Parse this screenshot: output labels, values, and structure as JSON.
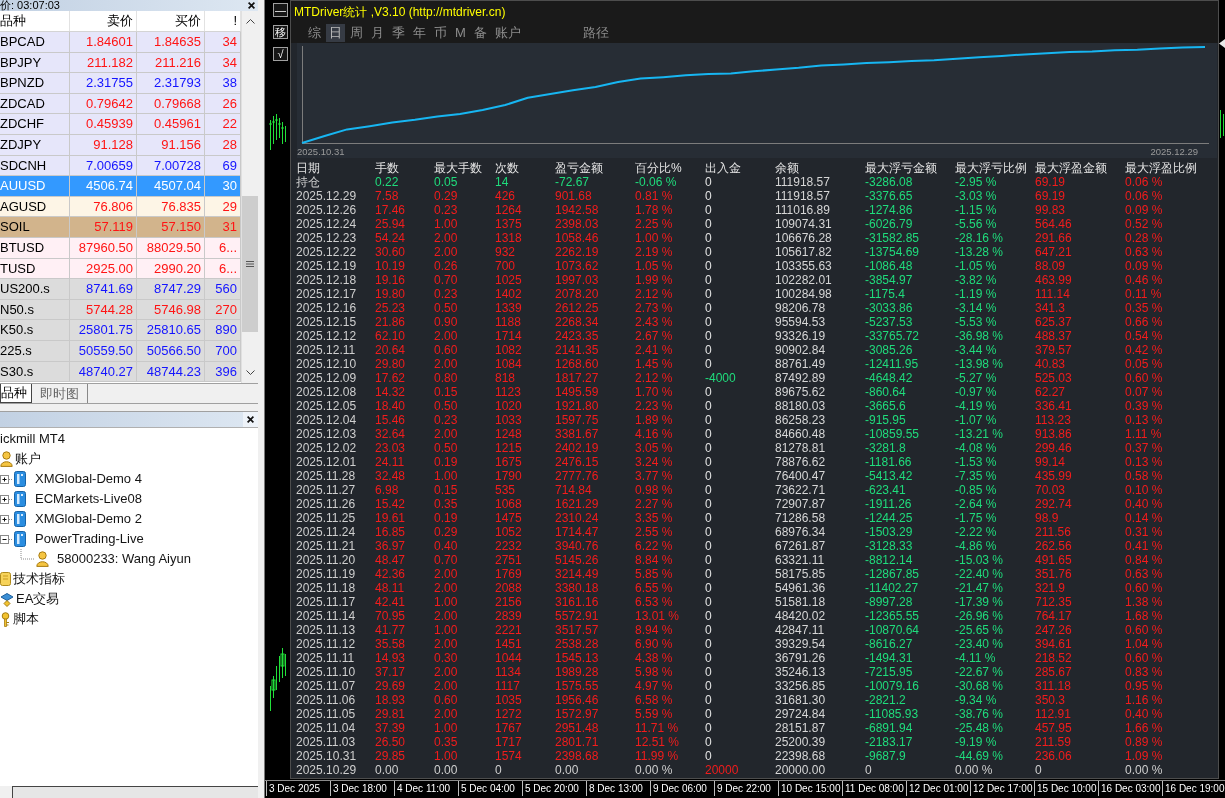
{
  "market_watch": {
    "time_label": "价: 03:07:03",
    "columns": [
      "品种",
      "卖价",
      "买价",
      "!"
    ],
    "rows": [
      {
        "symbol": "BPCAD",
        "bid": "1.84601",
        "ask": "1.84635",
        "spread": "34",
        "rising": false,
        "color": "#e6e6fa",
        "selected": false
      },
      {
        "symbol": "BPJPY",
        "bid": "211.182",
        "ask": "211.216",
        "spread": "34",
        "rising": false,
        "color": "#e6e6fa",
        "selected": false
      },
      {
        "symbol": "BPNZD",
        "bid": "2.31755",
        "ask": "2.31793",
        "spread": "38",
        "rising": true,
        "color": "#e6e6fa",
        "selected": false
      },
      {
        "symbol": "ZDCAD",
        "bid": "0.79642",
        "ask": "0.79668",
        "spread": "26",
        "rising": false,
        "color": "#e6e6fa",
        "selected": false
      },
      {
        "symbol": "ZDCHF",
        "bid": "0.45939",
        "ask": "0.45961",
        "spread": "22",
        "rising": false,
        "color": "#e6e6fa",
        "selected": false
      },
      {
        "symbol": "ZDJPY",
        "bid": "91.128",
        "ask": "91.156",
        "spread": "28",
        "rising": false,
        "color": "#e6e6fa",
        "selected": false
      },
      {
        "symbol": "SDCNH",
        "bid": "7.00659",
        "ask": "7.00728",
        "spread": "69",
        "rising": true,
        "color": "#e6e6fa",
        "selected": false
      },
      {
        "symbol": "AUUSD",
        "bid": "4506.74",
        "ask": "4507.04",
        "spread": "30",
        "selected": true
      },
      {
        "symbol": "AGUSD",
        "bid": "76.806",
        "ask": "76.835",
        "spread": "29",
        "rising": false,
        "color": "#fdf5e6",
        "selected": false
      },
      {
        "symbol": "SOIL",
        "bid": "57.119",
        "ask": "57.150",
        "spread": "31",
        "rising": false,
        "color": "#d2b48c",
        "selected": false
      },
      {
        "symbol": "BTUSD",
        "bid": "87960.50",
        "ask": "88029.50",
        "spread": "6...",
        "rising": false,
        "color": "#fff0f5",
        "selected": false
      },
      {
        "symbol": "TUSD",
        "bid": "2925.00",
        "ask": "2990.20",
        "spread": "6...",
        "rising": false,
        "color": "#fff0f5",
        "selected": false
      },
      {
        "symbol": "US200.s",
        "bid": "8741.69",
        "ask": "8747.29",
        "spread": "560",
        "rising": true,
        "color": "#dcdcdc",
        "selected": false
      },
      {
        "symbol": "N50.s",
        "bid": "5744.28",
        "ask": "5746.98",
        "spread": "270",
        "rising": false,
        "color": "#dcdcdc",
        "selected": false
      },
      {
        "symbol": "K50.s",
        "bid": "25801.75",
        "ask": "25810.65",
        "spread": "890",
        "rising": true,
        "color": "#dcdcdc",
        "selected": false
      },
      {
        "symbol": "225.s",
        "bid": "50559.50",
        "ask": "50566.50",
        "spread": "700",
        "rising": true,
        "color": "#dcdcdc",
        "selected": false
      },
      {
        "symbol": "S30.s",
        "bid": "48740.27",
        "ask": "48744.23",
        "spread": "396",
        "rising": true,
        "color": "#dcdcdc",
        "selected": false
      }
    ],
    "tabs": [
      {
        "label": "品种",
        "selected": true
      },
      {
        "label": "即时图",
        "selected": false
      }
    ]
  },
  "navigator": {
    "items": [
      {
        "label": "ickmill MT4",
        "children": [
          {
            "label": "账户",
            "kind": "accounts",
            "children": [
              {
                "label": "XMGlobal-Demo 4",
                "kind": "server",
                "expanded": false
              },
              {
                "label": "ECMarkets-Live08",
                "kind": "server",
                "expanded": false
              },
              {
                "label": "XMGlobal-Demo 2",
                "kind": "server",
                "expanded": false
              },
              {
                "label": "PowerTrading-Live",
                "kind": "server",
                "expanded": true,
                "children": [
                  {
                    "label": "58000233: Wang Aiyun",
                    "kind": "account"
                  }
                ]
              }
            ]
          },
          {
            "label": "技术指标",
            "kind": "indicators"
          },
          {
            "label": "EA交易",
            "kind": "experts"
          },
          {
            "label": "脚本",
            "kind": "scripts"
          }
        ]
      }
    ]
  },
  "price_chart": {
    "side_buttons": [
      "—",
      "移",
      "√"
    ],
    "time_axis": [
      "3 Dec 2025",
      "3 Dec 18:00",
      "4 Dec 11:00",
      "5 Dec 04:00",
      "5 Dec 20:00",
      "8 Dec 13:00",
      "9 Dec 06:00",
      "9 Dec 22:00",
      "10 Dec 15:00",
      "11 Dec 08:00",
      "12 Dec 01:00",
      "12 Dec 17:00",
      "15 Dec 10:00",
      "16 Dec 03:00",
      "16 Dec 19:00"
    ]
  },
  "stats_panel": {
    "title": "MTDriver统计 ,V3.10 (http://mtdriver.cn)",
    "tabs": [
      {
        "label": "综",
        "selected": false
      },
      {
        "label": "日",
        "selected": true
      },
      {
        "label": "周",
        "selected": false
      },
      {
        "label": "月",
        "selected": false
      },
      {
        "label": "季",
        "selected": false
      },
      {
        "label": "年",
        "selected": false
      },
      {
        "label": "币",
        "selected": false
      },
      {
        "label": "M",
        "selected": false
      },
      {
        "label": "备",
        "selected": false
      },
      {
        "label": "账户",
        "selected": false
      }
    ],
    "path_button": "路径",
    "curve": {
      "start_label": "2025.10.31",
      "end_label": "2025.12.29"
    },
    "table": {
      "columns": [
        "日期",
        "手数",
        "最大手数",
        "次数",
        "盈亏金额",
        "百分比%",
        "出入金",
        "余额",
        "最大浮亏金额",
        "最大浮亏比例",
        "最大浮盈金额",
        "最大浮盈比例"
      ],
      "rows": [
        {
          "kind": "position",
          "loss": true,
          "cells": [
            "持仓",
            "0.22",
            "0.05",
            "14",
            "-72.67",
            "-0.06 %",
            "0",
            "111918.57",
            "-3286.08",
            "-2.95 %",
            "69.19",
            "0.06 %"
          ]
        },
        {
          "kind": "day",
          "loss": false,
          "cells": [
            "2025.12.29",
            "7.58",
            "0.29",
            "426",
            "901.68",
            "0.81 %",
            "0",
            "111918.57",
            "-3376.65",
            "-3.03 %",
            "69.19",
            "0.06 %"
          ]
        },
        {
          "kind": "day",
          "loss": false,
          "cells": [
            "2025.12.26",
            "17.46",
            "0.23",
            "1264",
            "1942.58",
            "1.78 %",
            "0",
            "111016.89",
            "-1274.86",
            "-1.15 %",
            "99.83",
            "0.09 %"
          ]
        },
        {
          "kind": "day",
          "loss": false,
          "cells": [
            "2025.12.24",
            "25.94",
            "1.00",
            "1375",
            "2398.03",
            "2.25 %",
            "0",
            "109074.31",
            "-6026.79",
            "-5.56 %",
            "564.46",
            "0.52 %"
          ]
        },
        {
          "kind": "day",
          "loss": false,
          "cells": [
            "2025.12.23",
            "54.24",
            "2.00",
            "1318",
            "1058.46",
            "1.00 %",
            "0",
            "106676.28",
            "-31582.85",
            "-28.16 %",
            "291.66",
            "0.28 %"
          ]
        },
        {
          "kind": "day",
          "loss": false,
          "cells": [
            "2025.12.22",
            "30.60",
            "2.00",
            "932",
            "2262.19",
            "2.19 %",
            "0",
            "105617.82",
            "-13754.69",
            "-13.28 %",
            "647.21",
            "0.63 %"
          ]
        },
        {
          "kind": "day",
          "loss": false,
          "cells": [
            "2025.12.19",
            "10.19",
            "0.26",
            "700",
            "1073.62",
            "1.05 %",
            "0",
            "103355.63",
            "-1086.48",
            "-1.05 %",
            "88.09",
            "0.09 %"
          ]
        },
        {
          "kind": "day",
          "loss": false,
          "cells": [
            "2025.12.18",
            "19.16",
            "0.70",
            "1025",
            "1997.03",
            "1.99 %",
            "0",
            "102282.01",
            "-3854.97",
            "-3.82 %",
            "463.99",
            "0.46 %"
          ]
        },
        {
          "kind": "day",
          "loss": false,
          "cells": [
            "2025.12.17",
            "19.80",
            "0.23",
            "1402",
            "2078.20",
            "2.12 %",
            "0",
            "100284.98",
            "-1175.4",
            "-1.19 %",
            "111.14",
            "0.11 %"
          ]
        },
        {
          "kind": "day",
          "loss": false,
          "cells": [
            "2025.12.16",
            "25.23",
            "0.50",
            "1339",
            "2612.25",
            "2.73 %",
            "0",
            "98206.78",
            "-3033.86",
            "-3.14 %",
            "341.3",
            "0.35 %"
          ]
        },
        {
          "kind": "day",
          "loss": false,
          "cells": [
            "2025.12.15",
            "21.86",
            "0.90",
            "1188",
            "2268.34",
            "2.43 %",
            "0",
            "95594.53",
            "-5237.53",
            "-5.53 %",
            "625.37",
            "0.66 %"
          ]
        },
        {
          "kind": "day",
          "loss": false,
          "cells": [
            "2025.12.12",
            "62.10",
            "2.00",
            "1714",
            "2423.35",
            "2.67 %",
            "0",
            "93326.19",
            "-33765.72",
            "-36.98 %",
            "488.37",
            "0.54 %"
          ]
        },
        {
          "kind": "day",
          "loss": false,
          "cells": [
            "2025.12.11",
            "20.64",
            "0.60",
            "1082",
            "2141.35",
            "2.41 %",
            "0",
            "90902.84",
            "-3085.26",
            "-3.44 %",
            "379.57",
            "0.42 %"
          ]
        },
        {
          "kind": "day",
          "loss": false,
          "cells": [
            "2025.12.10",
            "29.80",
            "2.00",
            "1084",
            "1268.60",
            "1.45 %",
            "0",
            "88761.49",
            "-12411.95",
            "-13.98 %",
            "40.83",
            "0.05 %"
          ]
        },
        {
          "kind": "withdrawal",
          "loss": false,
          "cells": [
            "2025.12.09",
            "17.62",
            "0.80",
            "818",
            "1817.27",
            "2.12 %",
            "-4000",
            "87492.89",
            "-4648.42",
            "-5.27 %",
            "525.03",
            "0.60 %"
          ]
        },
        {
          "kind": "day",
          "loss": false,
          "cells": [
            "2025.12.08",
            "14.32",
            "0.15",
            "1123",
            "1495.59",
            "1.70 %",
            "0",
            "89675.62",
            "-860.64",
            "-0.97 %",
            "62.27",
            "0.07 %"
          ]
        },
        {
          "kind": "day",
          "loss": false,
          "cells": [
            "2025.12.05",
            "18.40",
            "0.50",
            "1020",
            "1921.80",
            "2.23 %",
            "0",
            "88180.03",
            "-3665.6",
            "-4.19 %",
            "336.41",
            "0.39 %"
          ]
        },
        {
          "kind": "day",
          "loss": false,
          "cells": [
            "2025.12.04",
            "15.46",
            "0.23",
            "1033",
            "1597.75",
            "1.89 %",
            "0",
            "86258.23",
            "-915.95",
            "-1.07 %",
            "113.23",
            "0.13 %"
          ]
        },
        {
          "kind": "day",
          "loss": false,
          "cells": [
            "2025.12.03",
            "32.64",
            "2.00",
            "1248",
            "3381.67",
            "4.16 %",
            "0",
            "84660.48",
            "-10859.55",
            "-13.21 %",
            "913.86",
            "1.11 %"
          ]
        },
        {
          "kind": "day",
          "loss": false,
          "cells": [
            "2025.12.02",
            "23.03",
            "0.50",
            "1215",
            "2402.19",
            "3.05 %",
            "0",
            "81278.81",
            "-3281.8",
            "-4.08 %",
            "299.46",
            "0.37 %"
          ]
        },
        {
          "kind": "day",
          "loss": false,
          "cells": [
            "2025.12.01",
            "24.11",
            "0.19",
            "1675",
            "2476.15",
            "3.24 %",
            "0",
            "78876.62",
            "-1181.66",
            "-1.53 %",
            "99.14",
            "0.13 %"
          ]
        },
        {
          "kind": "day",
          "loss": false,
          "cells": [
            "2025.11.28",
            "32.48",
            "1.00",
            "1790",
            "2777.76",
            "3.77 %",
            "0",
            "76400.47",
            "-5413.42",
            "-7.35 %",
            "435.99",
            "0.58 %"
          ]
        },
        {
          "kind": "day",
          "loss": false,
          "cells": [
            "2025.11.27",
            "6.98",
            "0.15",
            "535",
            "714.84",
            "0.98 %",
            "0",
            "73622.71",
            "-623.41",
            "-0.85 %",
            "70.03",
            "0.10 %"
          ]
        },
        {
          "kind": "day",
          "loss": false,
          "cells": [
            "2025.11.26",
            "15.42",
            "0.35",
            "1068",
            "1621.29",
            "2.27 %",
            "0",
            "72907.87",
            "-1911.26",
            "-2.64 %",
            "292.74",
            "0.40 %"
          ]
        },
        {
          "kind": "day",
          "loss": false,
          "cells": [
            "2025.11.25",
            "19.61",
            "0.19",
            "1475",
            "2310.24",
            "3.35 %",
            "0",
            "71286.58",
            "-1244.25",
            "-1.75 %",
            "98.9",
            "0.14 %"
          ]
        },
        {
          "kind": "day",
          "loss": false,
          "cells": [
            "2025.11.24",
            "16.85",
            "0.29",
            "1052",
            "1714.47",
            "2.55 %",
            "0",
            "68976.34",
            "-1503.29",
            "-2.22 %",
            "211.56",
            "0.31 %"
          ]
        },
        {
          "kind": "day",
          "loss": false,
          "cells": [
            "2025.11.21",
            "36.97",
            "0.40",
            "2232",
            "3940.76",
            "6.22 %",
            "0",
            "67261.87",
            "-3128.33",
            "-4.86 %",
            "262.56",
            "0.41 %"
          ]
        },
        {
          "kind": "day",
          "loss": false,
          "cells": [
            "2025.11.20",
            "48.47",
            "0.70",
            "2751",
            "5145.26",
            "8.84 %",
            "0",
            "63321.11",
            "-8812.14",
            "-15.03 %",
            "491.65",
            "0.84 %"
          ]
        },
        {
          "kind": "day",
          "loss": false,
          "cells": [
            "2025.11.19",
            "42.36",
            "2.00",
            "1769",
            "3214.49",
            "5.85 %",
            "0",
            "58175.85",
            "-12867.85",
            "-22.40 %",
            "351.76",
            "0.63 %"
          ]
        },
        {
          "kind": "day",
          "loss": false,
          "cells": [
            "2025.11.18",
            "48.11",
            "2.00",
            "2088",
            "3380.18",
            "6.55 %",
            "0",
            "54961.36",
            "-11402.27",
            "-21.47 %",
            "321.9",
            "0.60 %"
          ]
        },
        {
          "kind": "day",
          "loss": false,
          "cells": [
            "2025.11.17",
            "42.41",
            "1.00",
            "2156",
            "3161.16",
            "6.53 %",
            "0",
            "51581.18",
            "-8997.28",
            "-17.39 %",
            "712.35",
            "1.38 %"
          ]
        },
        {
          "kind": "day",
          "loss": false,
          "cells": [
            "2025.11.14",
            "70.95",
            "2.00",
            "2839",
            "5572.91",
            "13.01 %",
            "0",
            "48420.02",
            "-12365.55",
            "-26.96 %",
            "764.17",
            "1.68 %"
          ]
        },
        {
          "kind": "day",
          "loss": false,
          "cells": [
            "2025.11.13",
            "41.77",
            "1.00",
            "2221",
            "3517.57",
            "8.94 %",
            "0",
            "42847.11",
            "-10870.64",
            "-25.65 %",
            "247.26",
            "0.60 %"
          ]
        },
        {
          "kind": "day",
          "loss": false,
          "cells": [
            "2025.11.12",
            "35.58",
            "2.00",
            "1451",
            "2538.28",
            "6.90 %",
            "0",
            "39329.54",
            "-8616.27",
            "-23.40 %",
            "394.61",
            "1.04 %"
          ]
        },
        {
          "kind": "day",
          "loss": false,
          "cells": [
            "2025.11.11",
            "14.93",
            "0.30",
            "1044",
            "1545.13",
            "4.38 %",
            "0",
            "36791.26",
            "-1494.31",
            "-4.11 %",
            "218.52",
            "0.60 %"
          ]
        },
        {
          "kind": "day",
          "loss": false,
          "cells": [
            "2025.11.10",
            "37.17",
            "2.00",
            "1134",
            "1989.28",
            "5.98 %",
            "0",
            "35246.13",
            "-7215.95",
            "-22.67 %",
            "285.67",
            "0.83 %"
          ]
        },
        {
          "kind": "day",
          "loss": false,
          "cells": [
            "2025.11.07",
            "29.69",
            "2.00",
            "1117",
            "1575.55",
            "4.97 %",
            "0",
            "33256.85",
            "-10079.16",
            "-30.68 %",
            "311.18",
            "0.95 %"
          ]
        },
        {
          "kind": "day",
          "loss": false,
          "cells": [
            "2025.11.06",
            "18.93",
            "0.60",
            "1035",
            "1956.46",
            "6.58 %",
            "0",
            "31681.30",
            "-2821.2",
            "-9.34 %",
            "350.3",
            "1.16 %"
          ]
        },
        {
          "kind": "day",
          "loss": false,
          "cells": [
            "2025.11.05",
            "29.81",
            "2.00",
            "1272",
            "1572.97",
            "5.59 %",
            "0",
            "29724.84",
            "-11085.93",
            "-38.76 %",
            "112.91",
            "0.40 %"
          ]
        },
        {
          "kind": "day",
          "loss": false,
          "cells": [
            "2025.11.04",
            "37.39",
            "1.00",
            "1767",
            "2951.48",
            "11.71 %",
            "0",
            "28151.87",
            "-6891.94",
            "-25.48 %",
            "457.95",
            "1.66 %"
          ]
        },
        {
          "kind": "day",
          "loss": false,
          "cells": [
            "2025.11.03",
            "26.50",
            "0.35",
            "1717",
            "2801.71",
            "12.51 %",
            "0",
            "25200.39",
            "-2183.17",
            "-9.19 %",
            "211.59",
            "0.89 %"
          ]
        },
        {
          "kind": "day",
          "loss": false,
          "cells": [
            "2025.10.31",
            "29.85",
            "1.00",
            "1574",
            "2398.68",
            "11.99 %",
            "0",
            "22398.68",
            "-9687.9",
            "-44.69 %",
            "236.06",
            "1.09 %"
          ]
        },
        {
          "kind": "deposit",
          "cells": [
            "2025.10.29",
            "0.00",
            "0.00",
            "0",
            "0.00",
            "0.00 %",
            "20000",
            "20000.00",
            "0",
            "0.00 %",
            "0",
            "0.00 %"
          ]
        }
      ]
    }
  }
}
